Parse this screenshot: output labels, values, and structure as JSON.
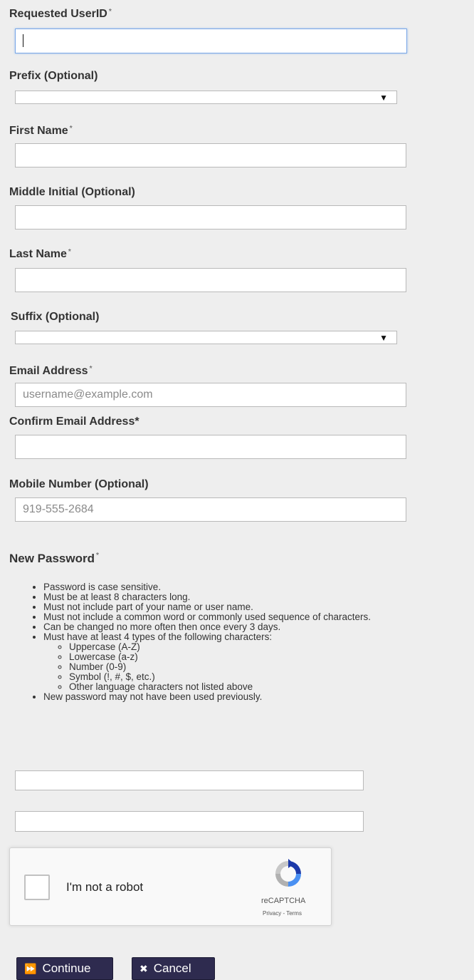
{
  "fields": {
    "userid": {
      "label": "Requested UserID",
      "required_mark": "*",
      "value": ""
    },
    "prefix": {
      "label": "Prefix (Optional)",
      "value": ""
    },
    "first_name": {
      "label": "First Name",
      "required_mark": "*",
      "value": ""
    },
    "middle_initial": {
      "label": "Middle Initial (Optional)",
      "value": ""
    },
    "last_name": {
      "label": "Last Name",
      "required_mark": "*",
      "value": ""
    },
    "suffix": {
      "label": "Suffix (Optional)",
      "value": ""
    },
    "email": {
      "label": "Email Address",
      "required_mark": "*",
      "placeholder": "username@example.com",
      "value": ""
    },
    "confirm_email": {
      "label": "Confirm Email Address*",
      "value": ""
    },
    "mobile": {
      "label": "Mobile Number (Optional)",
      "placeholder": "919-555-2684",
      "value": ""
    }
  },
  "password": {
    "title": "New Password",
    "required_mark": "*",
    "rules": [
      "Password is case sensitive.",
      "Must be at least 8 characters long.",
      "Must not include part of your name or user name.",
      "Must not include a common word or commonly used sequence of characters.",
      "Can be changed no more often then once every 3 days.",
      "Must have at least 4 types of the following characters:"
    ],
    "char_types": [
      "Uppercase (A-Z)",
      "Lowercase (a-z)",
      "Number (0-9)",
      "Symbol (!, #, $, etc.)",
      "Other language characters not listed above"
    ],
    "last_rule": "New password may not have been used previously."
  },
  "captcha": {
    "label": "I'm not a robot",
    "brand": "reCAPTCHA",
    "links": "Privacy - Terms"
  },
  "buttons": {
    "continue": "Continue",
    "cancel": "Cancel"
  },
  "icons": {
    "select_arrow": "▼",
    "continue": "⏩",
    "cancel": "✖"
  },
  "colors": {
    "button_bg": "#2e2b4f",
    "focus_border": "#7aa7e6",
    "background": "#eeeeee"
  }
}
